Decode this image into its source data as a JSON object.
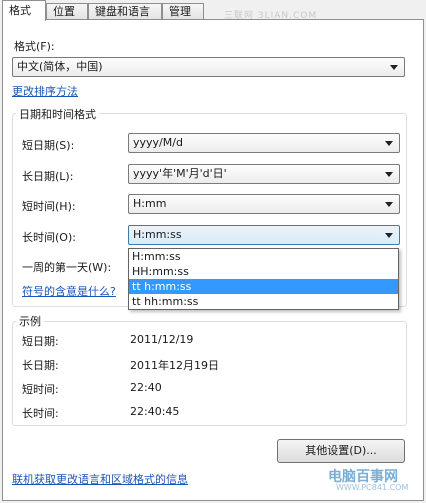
{
  "tabs": [
    "格式",
    "位置",
    "键盘和语言",
    "管理"
  ],
  "format_label": "格式(F):",
  "format_value": "中文(简体，中国)",
  "sort_link": "更改排序方法",
  "datetime_group_title": "日期和时间格式",
  "short_date_label": "短日期(S):",
  "short_date_value": "yyyy/M/d",
  "long_date_label": "长日期(L):",
  "long_date_value": "yyyy'年'M'月'd'日'",
  "short_time_label": "短时间(H):",
  "short_time_value": "H:mm",
  "long_time_label": "长时间(O):",
  "long_time_value": "H:mm:ss",
  "first_day_label": "一周的第一天(W):",
  "symbols_link": "符号的含意是什么?",
  "dropdown_options": [
    "H:mm:ss",
    "HH:mm:ss",
    "tt h:mm:ss",
    "tt hh:mm:ss"
  ],
  "dropdown_selected_index": 2,
  "example_group_title": "示例",
  "examples": [
    {
      "label": "短日期:",
      "value": "2011/12/19"
    },
    {
      "label": "长日期:",
      "value": "2011年12月19日"
    },
    {
      "label": "短时间:",
      "value": "22:40"
    },
    {
      "label": "长时间:",
      "value": "22:40:45"
    }
  ],
  "other_settings_button": "其他设置(D)...",
  "online_info_link": "联机获取更改语言和区域格式的信息",
  "watermark_top": "三联网 3LIAN.COM",
  "watermark_logo": "电脑百事网",
  "watermark_logo_sub": "WWW.PC841.COM",
  "colors": {
    "link": "#1a55b8",
    "selection": "#3399ff",
    "border": "#8e8f8f"
  }
}
